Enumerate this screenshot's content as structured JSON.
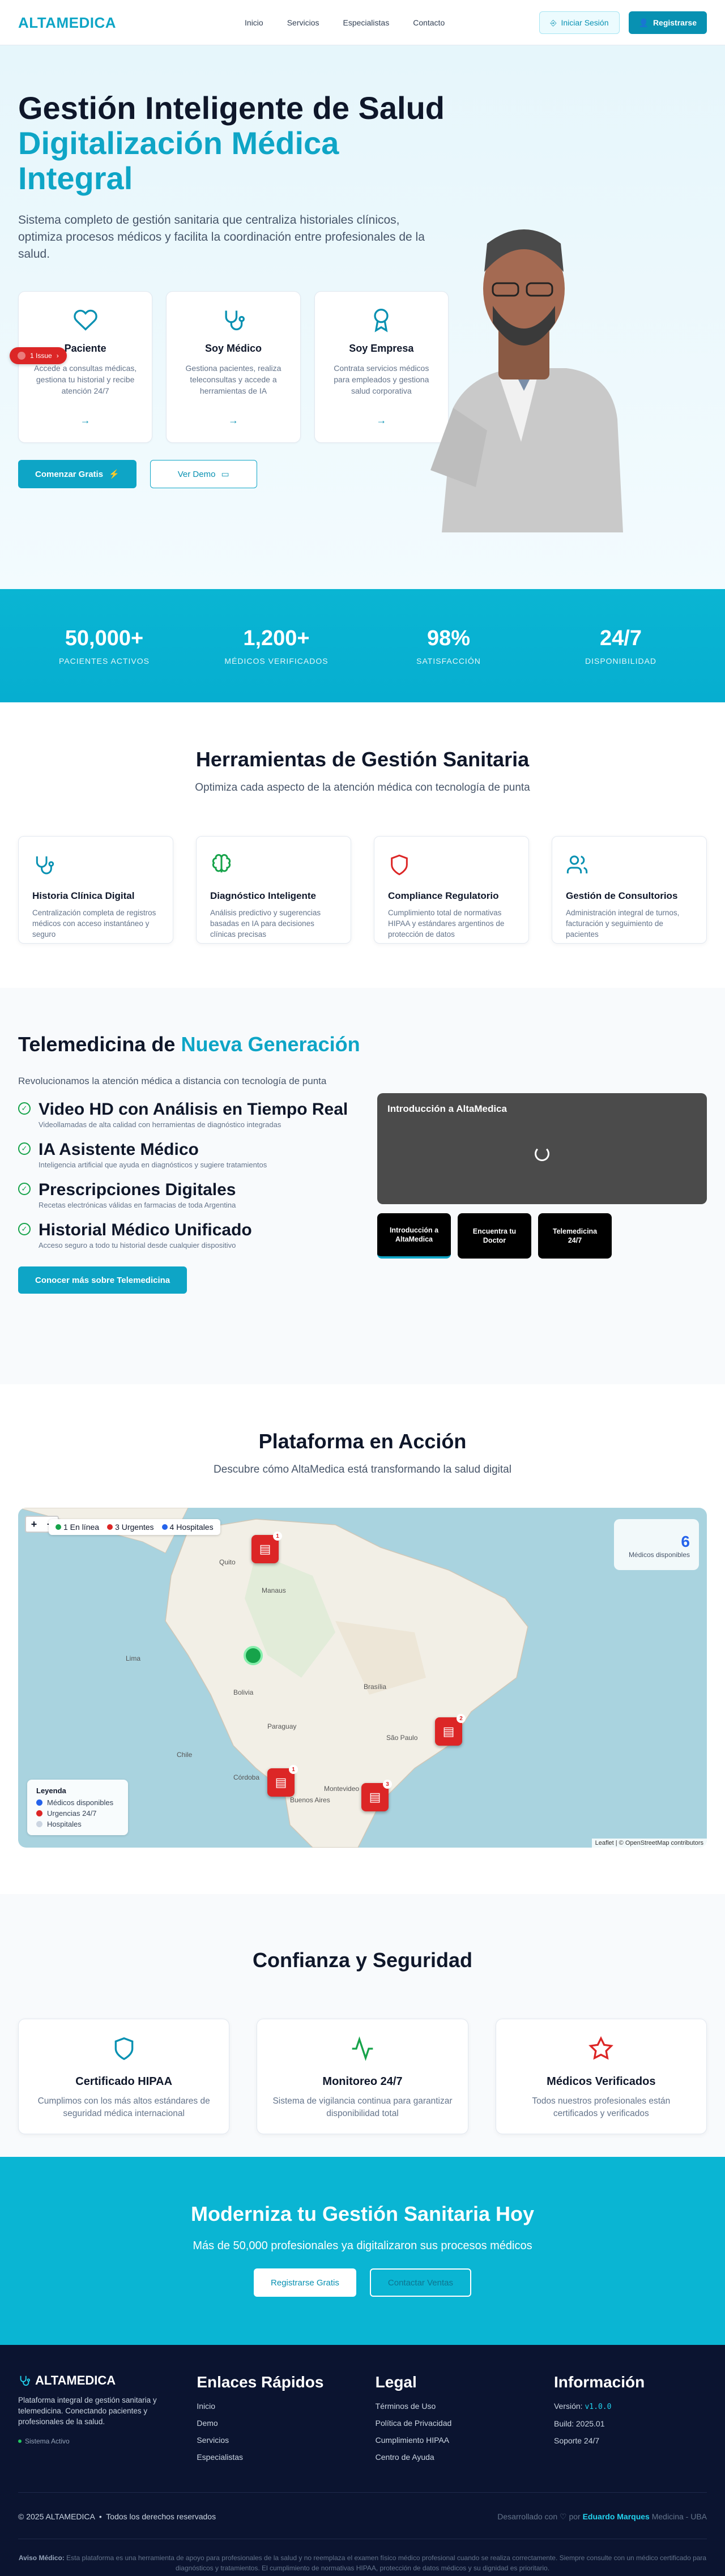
{
  "nav": {
    "logo": "ALTAMEDICA",
    "links": [
      "Inicio",
      "Servicios",
      "Especialistas",
      "Contacto"
    ],
    "login": "Iniciar Sesión",
    "register": "Registrarse"
  },
  "hero": {
    "title1": "Gestión Inteligente de Salud",
    "title2": "Digitalización Médica Integral",
    "lead": "Sistema completo de gestión sanitaria que centraliza historiales clínicos, optimiza procesos médicos y facilita la coordinación entre profesionales de la salud.",
    "cards": [
      {
        "title": "Paciente",
        "desc": "Accede a consultas médicas, gestiona tu historial y recibe atención 24/7",
        "icon": "heart-icon"
      },
      {
        "title": "Soy Médico",
        "desc": "Gestiona pacientes, realiza teleconsultas y accede a herramientas de IA",
        "icon": "stethoscope-icon"
      },
      {
        "title": "Soy Empresa",
        "desc": "Contrata servicios médicos para empleados y gestiona salud corporativa",
        "icon": "award-icon"
      }
    ],
    "issue": "1 Issue",
    "cta_primary": "Comenzar Gratis",
    "cta_secondary": "Ver Demo"
  },
  "stats": [
    {
      "value": "50,000+",
      "label": "PACIENTES ACTIVOS"
    },
    {
      "value": "1,200+",
      "label": "MÉDICOS VERIFICADOS"
    },
    {
      "value": "98%",
      "label": "SATISFACCIÓN"
    },
    {
      "value": "24/7",
      "label": "DISPONIBILIDAD"
    }
  ],
  "tools": {
    "title": "Herramientas de Gestión Sanitaria",
    "subtitle": "Optimiza cada aspecto de la atención médica con tecnología de punta",
    "items": [
      {
        "title": "Historia Clínica Digital",
        "desc": "Centralización completa de registros médicos con acceso instantáneo y seguro",
        "color": "#0891b2"
      },
      {
        "title": "Diagnóstico Inteligente",
        "desc": "Análisis predictivo y sugerencias basadas en IA para decisiones clínicas precisas",
        "color": "#16a34a"
      },
      {
        "title": "Compliance Regulatorio",
        "desc": "Cumplimiento total de normativas HIPAA y estándares argentinos de protección de datos",
        "color": "#dc2626"
      },
      {
        "title": "Gestión de Consultorios",
        "desc": "Administración integral de turnos, facturación y seguimiento de pacientes",
        "color": "#0891b2"
      }
    ]
  },
  "tele": {
    "title_a": "Telemedicina de",
    "title_b": "Nueva Generación",
    "intro": "Revolucionamos la atención médica a distancia con tecnología de punta",
    "features": [
      {
        "title": "Video HD con Análisis en Tiempo Real",
        "desc": "Videollamadas de alta calidad con herramientas de diagnóstico integradas"
      },
      {
        "title": "IA Asistente Médico",
        "desc": "Inteligencia artificial que ayuda en diagnósticos y sugiere tratamientos"
      },
      {
        "title": "Prescripciones Digitales",
        "desc": "Recetas electrónicas válidas en farmacias de toda Argentina"
      },
      {
        "title": "Historial Médico Unificado",
        "desc": "Acceso seguro a todo tu historial desde cualquier dispositivo"
      }
    ],
    "cta": "Conocer más sobre Telemedicina",
    "video_title": "Introducción a AltaMedica",
    "video_tabs": [
      "Introducción a AltaMedica",
      "Encuentra tu Doctor",
      "Telemedicina 24/7"
    ]
  },
  "platform": {
    "title": "Plataforma en Acción",
    "subtitle": "Descubre cómo AltaMedica está transformando la salud digital",
    "legend_top": [
      "1 En línea",
      "3 Urgentes",
      "4 Hospitales"
    ],
    "stat_num": "6",
    "stat_text": "Médicos disponibles",
    "legend_title": "Leyenda",
    "legend_items": [
      "Médicos disponibles",
      "Urgencias 24/7",
      "Hospitales"
    ],
    "attribution": "Leaflet | © OpenStreetMap contributors",
    "map_labels": [
      "Quito",
      "Manaus",
      "Brasília",
      "Lima",
      "Bolivia",
      "Paraguay",
      "São Paulo",
      "Chile",
      "Córdoba",
      "Buenos Aires",
      "Montevideo"
    ]
  },
  "trust": {
    "title": "Confianza y Seguridad",
    "items": [
      {
        "title": "Certificado HIPAA",
        "desc": "Cumplimos con los más altos estándares de seguridad médica internacional",
        "color": "#0891b2"
      },
      {
        "title": "Monitoreo 24/7",
        "desc": "Sistema de vigilancia continua para garantizar disponibilidad total",
        "color": "#16a34a"
      },
      {
        "title": "Médicos Verificados",
        "desc": "Todos nuestros profesionales están certificados y verificados",
        "color": "#dc2626"
      }
    ]
  },
  "cta": {
    "title": "Moderniza tu Gestión Sanitaria Hoy",
    "subtitle": "Más de 50,000 profesionales ya digitalizaron sus procesos médicos",
    "btn1": "Registrarse Gratis",
    "btn2": "Contactar Ventas"
  },
  "footer": {
    "logo": "ALTAMEDICA",
    "desc": "Plataforma integral de gestión sanitaria y telemedicina. Conectando pacientes y profesionales de la salud.",
    "status": "Sistema Activo",
    "quick_title": "Enlaces Rápidos",
    "quick": [
      "Inicio",
      "Demo",
      "Servicios",
      "Especialistas"
    ],
    "legal_title": "Legal",
    "legal": [
      "Términos de Uso",
      "Política de Privacidad",
      "Cumplimiento HIPAA",
      "Centro de Ayuda"
    ],
    "info_title": "Información",
    "version_label": "Versión:",
    "version": "v1.0.0",
    "build": "Build: 2025.01",
    "support": "Soporte 24/7",
    "copyright": "© 2025 ALTAMEDICA",
    "rights": "Todos los derechos reservados",
    "dev_prefix": "Desarrollado con",
    "dev_by": "por",
    "dev_name": "Eduardo Marques",
    "dev_suffix": "Medicina - UBA",
    "disclaimer_label": "Aviso Médico:",
    "disclaimer": "Esta plataforma es una herramienta de apoyo para profesionales de la salud y no reemplaza el examen físico médico profesional cuando se realiza correctamente. Siempre consulte con un médico certificado para diagnósticos y tratamientos. El cumplimiento de normativas HIPAA, protección de datos médicos y su dignidad es prioritario."
  }
}
